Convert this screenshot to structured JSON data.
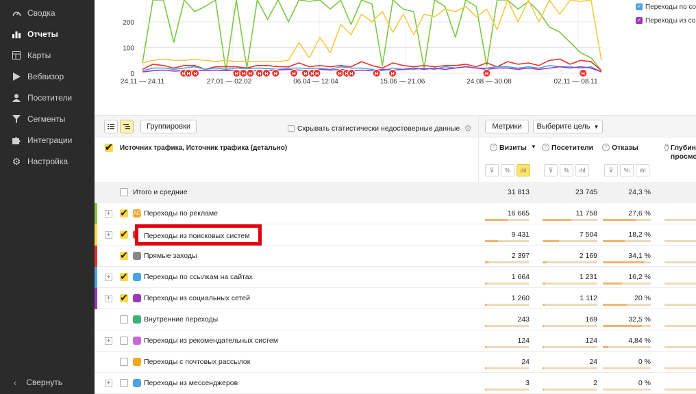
{
  "sidebar": {
    "items": [
      {
        "label": "Сводка",
        "icon": "dashboard-icon"
      },
      {
        "label": "Отчеты",
        "icon": "reports-icon",
        "active": true
      },
      {
        "label": "Карты",
        "icon": "maps-icon"
      },
      {
        "label": "Вебвизор",
        "icon": "play-icon"
      },
      {
        "label": "Посетители",
        "icon": "user-icon"
      },
      {
        "label": "Сегменты",
        "icon": "filter-icon"
      },
      {
        "label": "Интеграции",
        "icon": "puzzle-icon"
      },
      {
        "label": "Настройка",
        "icon": "gear-icon"
      }
    ],
    "collapse_label": "Свернуть"
  },
  "chart_data": {
    "type": "line",
    "y_ticks": [
      "0",
      "100",
      "200"
    ],
    "x_tick_labels": [
      "24.11 — 24.11",
      "27.01 — 02.02",
      "06.04 — 12.04",
      "15.06 — 21.06",
      "24.08 — 30.08",
      "02.11 — 08.11"
    ],
    "legend": [
      {
        "name": "Переходы по со",
        "color": "#4aa3e8"
      },
      {
        "name": "Переходы из со",
        "color": "#9b3bb8"
      }
    ],
    "series": [
      {
        "color": "#7ac943",
        "values": [
          40,
          300,
          300,
          120,
          300,
          240,
          260,
          300,
          10,
          300,
          20,
          300,
          210,
          300,
          200,
          300,
          280,
          300,
          250,
          300,
          190,
          300,
          270,
          30,
          300,
          250,
          240,
          20,
          300,
          260,
          140,
          300,
          260,
          30,
          300,
          300,
          250,
          280,
          240,
          180,
          160,
          120,
          80,
          60,
          10
        ]
      },
      {
        "color": "#f7c948",
        "values": [
          40,
          50,
          55,
          50,
          50,
          55,
          50,
          45,
          50,
          45,
          45,
          45,
          45,
          45,
          50,
          120,
          60,
          140,
          80,
          190,
          150,
          230,
          200,
          240,
          160,
          230,
          150,
          230,
          220,
          250,
          240,
          260,
          220,
          250,
          170,
          300,
          200,
          300,
          200,
          300,
          230,
          290,
          280,
          300,
          50
        ]
      },
      {
        "color": "#e8332a",
        "values": [
          15,
          35,
          30,
          20,
          30,
          30,
          15,
          25,
          25,
          25,
          20,
          30,
          30,
          25,
          25,
          40,
          25,
          30,
          25,
          30,
          25,
          45,
          30,
          20,
          40,
          30,
          25,
          30,
          25,
          30,
          30,
          35,
          25,
          40,
          25,
          45,
          35,
          40,
          30,
          50,
          55,
          35,
          50,
          45,
          10
        ]
      },
      {
        "color": "#4aa3e8",
        "values": [
          10,
          20,
          20,
          15,
          20,
          25,
          15,
          20,
          15,
          20,
          18,
          20,
          18,
          15,
          20,
          20,
          18,
          20,
          15,
          25,
          20,
          20,
          15,
          10,
          20,
          15,
          15,
          20,
          15,
          25,
          20,
          25,
          20,
          20,
          25,
          25,
          20,
          25,
          20,
          30,
          25,
          25,
          20,
          25,
          5
        ]
      },
      {
        "color": "#9b3bb8",
        "values": [
          5,
          10,
          12,
          8,
          10,
          12,
          10,
          12,
          10,
          12,
          8,
          10,
          10,
          12,
          15,
          12,
          10,
          15,
          12,
          15,
          10,
          12,
          10,
          15,
          12,
          15,
          20,
          15,
          20,
          15,
          20,
          25,
          20,
          15,
          20,
          20,
          15,
          20,
          15,
          20,
          25,
          20,
          25,
          20,
          5
        ]
      }
    ],
    "ylim": [
      0,
      300
    ],
    "annotation_marker": "Н",
    "annotation_positions": [
      0.09,
      0.1,
      0.115,
      0.205,
      0.22,
      0.235,
      0.255,
      0.27,
      0.29,
      0.33,
      0.355,
      0.37,
      0.38,
      0.43,
      0.445,
      0.455,
      0.51,
      0.545,
      0.75,
      0.96
    ]
  },
  "toolbar": {
    "groupings_label": "Группировки",
    "hide_unreliable_label": "Скрывать статистически недостоверные данные",
    "metrics_label": "Метрики",
    "goal_label": "Выберите цель"
  },
  "table": {
    "dimension_header": "Источник трафика, Источник трафика (детально)",
    "columns": [
      {
        "label": "Визиты",
        "sort": "▼"
      },
      {
        "label": "Посетители"
      },
      {
        "label": "Отказы"
      },
      {
        "label": "Глубина просмотра"
      }
    ],
    "column_icons": [
      "⊽",
      "%",
      "ılıl"
    ],
    "total": {
      "label": "Итого и средние",
      "visits": "31 813",
      "visitors": "23 745",
      "bounce": "24,3 %"
    },
    "rows": [
      {
        "label": "Переходы по рекламе",
        "visits": "16 665",
        "visitors": "11 758",
        "bounce": "27,6 %",
        "checked": true,
        "expandable": true,
        "stripe": "#8dc63f",
        "icon": "ad-icon",
        "icon_color": "#f5a623",
        "icon_text": "AD",
        "share": 0.52
      },
      {
        "label": "Переходы из поисковых систем",
        "visits": "9 431",
        "visitors": "7 504",
        "bounce": "18,2 %",
        "checked": true,
        "expandable": true,
        "stripe": "#ffd942",
        "icon": "search-icon",
        "icon_color": "#e8332a",
        "share": 0.3
      },
      {
        "label": "Прямые заходы",
        "visits": "2 397",
        "visitors": "2 169",
        "bounce": "34,1 %",
        "checked": true,
        "expandable": false,
        "stripe": "#e8332a",
        "icon": "direct-icon",
        "icon_color": "#888888",
        "share": 0.08
      },
      {
        "label": "Переходы по ссылкам на сайтах",
        "visits": "1 664",
        "visitors": "1 231",
        "bounce": "16,2 %",
        "checked": true,
        "expandable": true,
        "stripe": "#4aa3e8",
        "icon": "link-icon",
        "icon_color": "#4aa3e8",
        "share": 0.05
      },
      {
        "label": "Переходы из социальных сетей",
        "visits": "1 260",
        "visitors": "1 112",
        "bounce": "20 %",
        "checked": true,
        "expandable": true,
        "stripe": "#9b3bb8",
        "icon": "people-icon",
        "icon_color": "#9b3bb8",
        "share": 0.04
      },
      {
        "label": "Внутренние переходы",
        "visits": "243",
        "visitors": "169",
        "bounce": "32,5 %",
        "checked": false,
        "expandable": false,
        "stripe": "",
        "icon": "home-icon",
        "icon_color": "#3cb371",
        "share": 0.01
      },
      {
        "label": "Переходы из рекомендательных систем",
        "visits": "124",
        "visitors": "124",
        "bounce": "4,84 %",
        "checked": false,
        "expandable": true,
        "stripe": "",
        "icon": "thumbs-up-icon",
        "icon_color": "#c46bd8",
        "share": 0.005
      },
      {
        "label": "Переходы с почтовых рассылок",
        "visits": "24",
        "visitors": "24",
        "bounce": "0 %",
        "checked": false,
        "expandable": false,
        "stripe": "",
        "icon": "bell-icon",
        "icon_color": "#f5a623",
        "share": 0.002
      },
      {
        "label": "Переходы из мессенджеров",
        "visits": "3",
        "visitors": "2",
        "bounce": "0 %",
        "checked": false,
        "expandable": true,
        "stripe": "",
        "icon": "chat-icon",
        "icon_color": "#4aa3e8",
        "share": 0.001
      }
    ]
  }
}
